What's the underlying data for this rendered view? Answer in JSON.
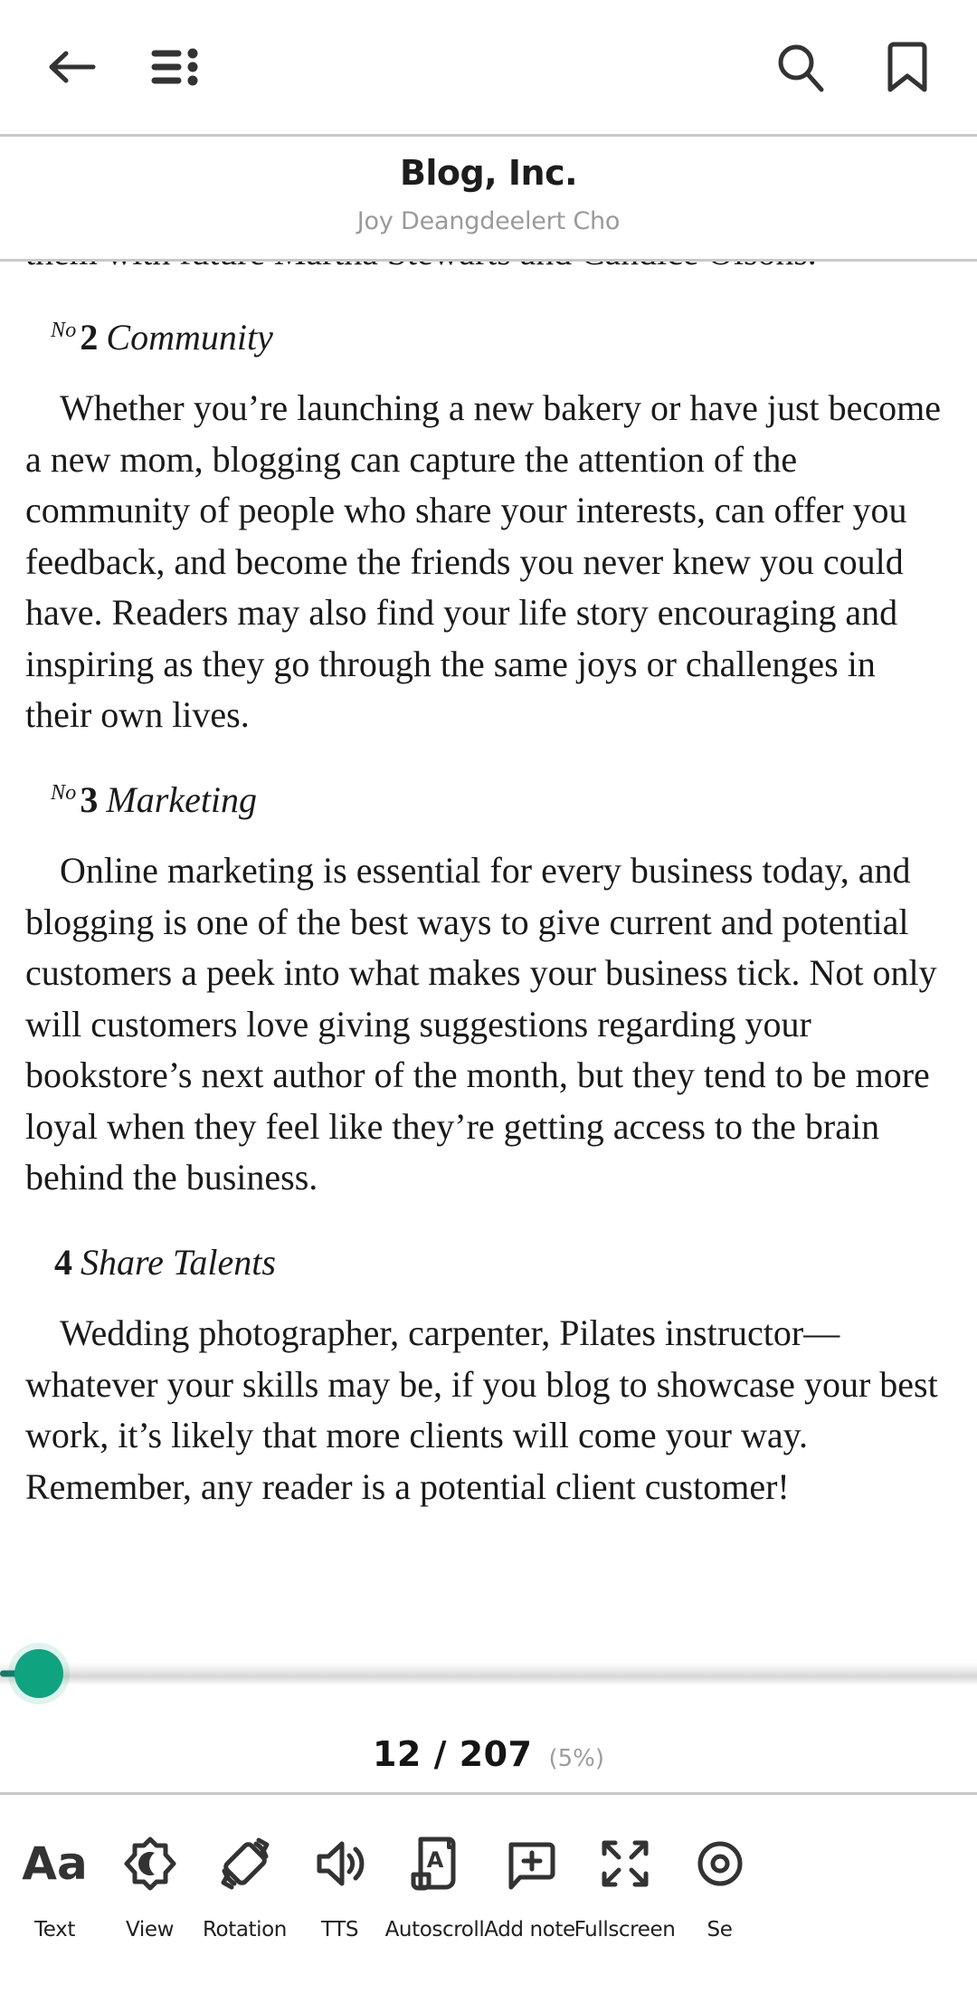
{
  "topbar": {
    "back_icon": "back-arrow-icon",
    "toc_icon": "table-of-contents-icon",
    "search_icon": "search-icon",
    "bookmark_icon": "bookmark-icon"
  },
  "book": {
    "title": "Blog, Inc.",
    "author": "Joy Deangdeelert Cho"
  },
  "content": {
    "clipped_top_line": "them with future Martha Stewarts and Candice Olsons.",
    "sections": [
      {
        "no_prefix": "No",
        "number": "2",
        "title": "Community",
        "paragraph": "Whether you’re launching a new bakery or have just become a new mom, blogging can capture the attention of the community of people who share your interests, can offer you feedback, and become the friends you never knew you could have. Readers may also find your life story encouraging and inspiring as they go through the same joys or challenges in their own lives."
      },
      {
        "no_prefix": "No",
        "number": "3",
        "title": "Marketing",
        "paragraph": "Online marketing is essential for every business today, and blogging is one of the best ways to give current and potential customers a peek into what makes your business tick. Not only will customers love giving suggestions regarding your bookstore’s next author of the month, but they tend to be more loyal when they feel like they’re getting access to the brain behind the business."
      },
      {
        "no_prefix": "",
        "number": "4",
        "title": "Share Talents",
        "paragraph": "Wedding photographer, carpenter, Pilates instructor—whatever your skills may be, if you blog to showcase your best work, it’s likely that more clients will come your way. Remember, any reader is a potential client customer!"
      }
    ]
  },
  "progress": {
    "page_label": "12 / 207",
    "percent_label": "(5%)",
    "thumb_color": "#10a37f",
    "track_fill_color": "#14776a"
  },
  "bottom_toolbar": {
    "items": [
      {
        "label": "Text",
        "icon": "text-format-icon"
      },
      {
        "label": "View",
        "icon": "brightness-moon-icon"
      },
      {
        "label": "Rotation",
        "icon": "screen-rotation-icon"
      },
      {
        "label": "TTS",
        "icon": "speaker-volume-icon"
      },
      {
        "label": "Autoscroll",
        "icon": "autoscroll-document-icon"
      },
      {
        "label": "Add note",
        "icon": "add-note-icon"
      },
      {
        "label": "Fullscreen",
        "icon": "fullscreen-expand-icon"
      },
      {
        "label": "Se",
        "icon": "settings-icon"
      }
    ]
  }
}
